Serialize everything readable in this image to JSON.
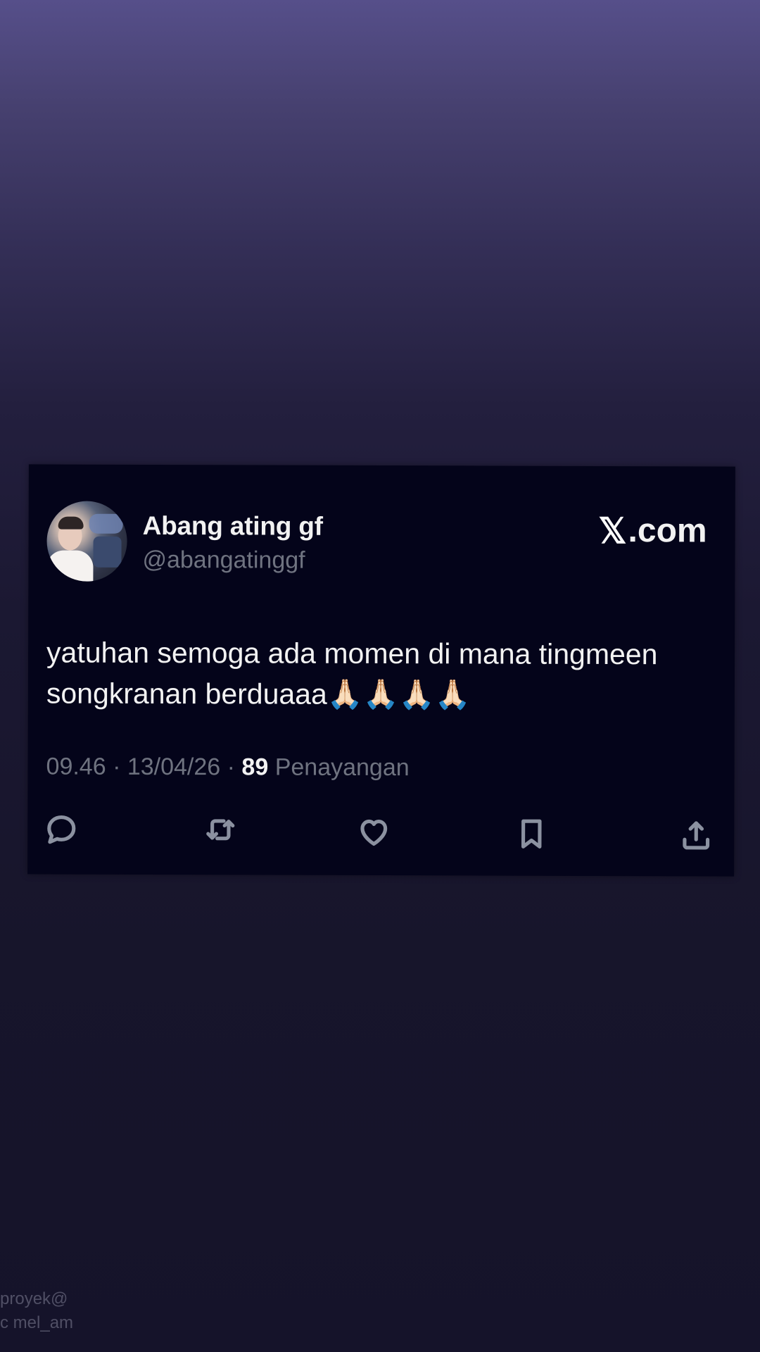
{
  "tweet": {
    "author_name": "Abang ating gf",
    "handle": "@abangatinggf",
    "source_label": ".com",
    "x_icon": "𝕏",
    "text": "yatuhan semoga ada momen di mana tingmeen songkranan berduaaa🙏🏻🙏🏻🙏🏻🙏🏻",
    "time": "09.46",
    "separator": " · ",
    "date": "13/04/26",
    "views_count": "89",
    "views_label": " Penayangan"
  },
  "actions": {
    "reply": "reply-icon",
    "retweet": "retweet-icon",
    "like": "heart-icon",
    "bookmark": "bookmark-icon",
    "share": "share-icon"
  },
  "watermark": {
    "line1": "proyek@",
    "line2": "c mel_am"
  }
}
